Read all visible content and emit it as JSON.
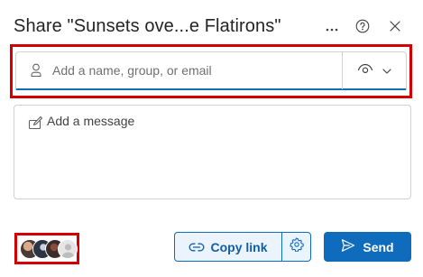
{
  "dialog": {
    "title": "Share \"Sunsets ove...e Flatirons\"",
    "more_icon": "more-horizontal-icon",
    "help_icon": "help-circle-icon",
    "close_icon": "close-icon"
  },
  "recipient": {
    "icon": "person-icon",
    "placeholder": "Add a name, group, or email",
    "value": "",
    "permission_icon": "eye-icon",
    "dropdown_icon": "chevron-down-icon"
  },
  "message": {
    "icon": "compose-icon",
    "placeholder": "Add a message",
    "value": ""
  },
  "footer": {
    "copy_link_label": "Copy link",
    "copy_link_icon": "link-icon",
    "settings_icon": "gear-icon",
    "send_label": "Send",
    "send_icon": "send-icon"
  },
  "colors": {
    "accent": "#0f6cbd",
    "highlight": "#d40000"
  }
}
